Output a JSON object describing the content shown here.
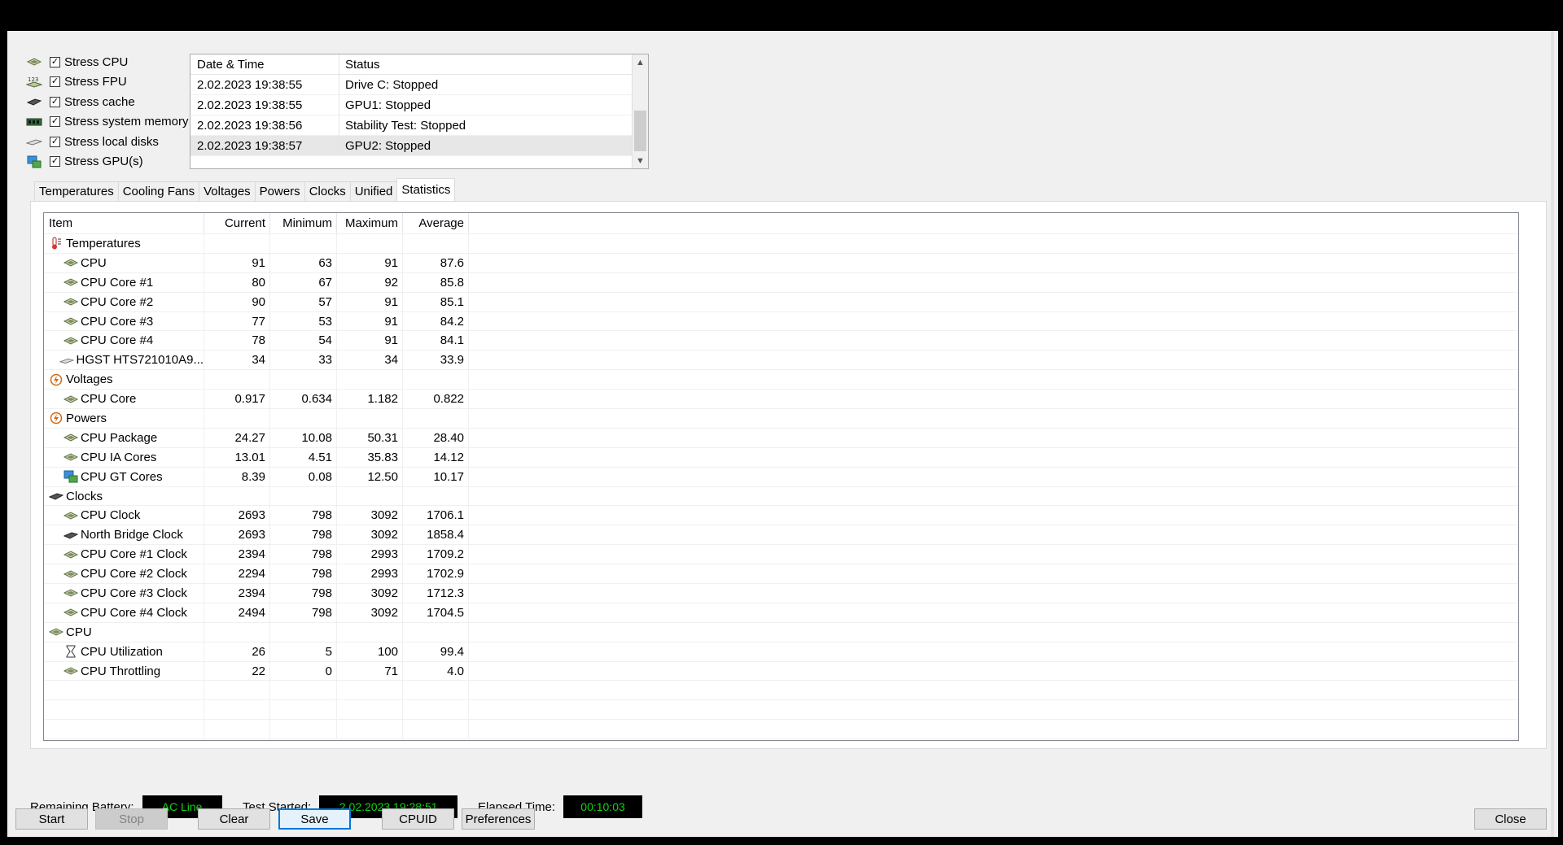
{
  "stress_options": [
    {
      "label": "Stress CPU",
      "checked": true,
      "icon": "cpu-chip-icon"
    },
    {
      "label": "Stress FPU",
      "checked": true,
      "icon": "fpu-numbers-icon"
    },
    {
      "label": "Stress cache",
      "checked": true,
      "icon": "cache-icon"
    },
    {
      "label": "Stress system memory",
      "checked": true,
      "icon": "memory-module-icon"
    },
    {
      "label": "Stress local disks",
      "checked": true,
      "icon": "disk-drive-icon"
    },
    {
      "label": "Stress GPU(s)",
      "checked": true,
      "icon": "gpu-icon"
    }
  ],
  "log": {
    "headers": {
      "datetime": "Date & Time",
      "status": "Status"
    },
    "rows": [
      {
        "datetime": "2.02.2023 19:38:55",
        "status": "Drive C: Stopped"
      },
      {
        "datetime": "2.02.2023 19:38:55",
        "status": "GPU1: Stopped"
      },
      {
        "datetime": "2.02.2023 19:38:56",
        "status": "Stability Test: Stopped"
      },
      {
        "datetime": "2.02.2023 19:38:57",
        "status": "GPU2: Stopped"
      }
    ]
  },
  "tabs": [
    "Temperatures",
    "Cooling Fans",
    "Voltages",
    "Powers",
    "Clocks",
    "Unified",
    "Statistics"
  ],
  "active_tab": "Statistics",
  "stats": {
    "headers": {
      "item": "Item",
      "current": "Current",
      "minimum": "Minimum",
      "maximum": "Maximum",
      "average": "Average"
    },
    "rows": [
      {
        "type": "group",
        "item": "Temperatures",
        "icon": "thermometer-icon"
      },
      {
        "type": "item",
        "item": "CPU",
        "icon": "cpu-chip-icon",
        "current": "91",
        "minimum": "63",
        "maximum": "91",
        "average": "87.6"
      },
      {
        "type": "item",
        "item": "CPU Core #1",
        "icon": "cpu-chip-icon",
        "current": "80",
        "minimum": "67",
        "maximum": "92",
        "average": "85.8"
      },
      {
        "type": "item",
        "item": "CPU Core #2",
        "icon": "cpu-chip-icon",
        "current": "90",
        "minimum": "57",
        "maximum": "91",
        "average": "85.1"
      },
      {
        "type": "item",
        "item": "CPU Core #3",
        "icon": "cpu-chip-icon",
        "current": "77",
        "minimum": "53",
        "maximum": "91",
        "average": "84.2"
      },
      {
        "type": "item",
        "item": "CPU Core #4",
        "icon": "cpu-chip-icon",
        "current": "78",
        "minimum": "54",
        "maximum": "91",
        "average": "84.1"
      },
      {
        "type": "item",
        "item": "HGST HTS721010A9...",
        "icon": "disk-drive-icon",
        "current": "34",
        "minimum": "33",
        "maximum": "34",
        "average": "33.9"
      },
      {
        "type": "group",
        "item": "Voltages",
        "icon": "voltage-icon"
      },
      {
        "type": "item",
        "item": "CPU Core",
        "icon": "cpu-chip-icon",
        "current": "0.917",
        "minimum": "0.634",
        "maximum": "1.182",
        "average": "0.822"
      },
      {
        "type": "group",
        "item": "Powers",
        "icon": "power-icon"
      },
      {
        "type": "item",
        "item": "CPU Package",
        "icon": "cpu-chip-icon",
        "current": "24.27",
        "minimum": "10.08",
        "maximum": "50.31",
        "average": "28.40"
      },
      {
        "type": "item",
        "item": "CPU IA Cores",
        "icon": "cpu-chip-icon",
        "current": "13.01",
        "minimum": "4.51",
        "maximum": "35.83",
        "average": "14.12"
      },
      {
        "type": "item",
        "item": "CPU GT Cores",
        "icon": "gpu-icon",
        "current": "8.39",
        "minimum": "0.08",
        "maximum": "12.50",
        "average": "10.17"
      },
      {
        "type": "group",
        "item": "Clocks",
        "icon": "clock-chip-icon"
      },
      {
        "type": "item",
        "item": "CPU Clock",
        "icon": "cpu-chip-icon",
        "current": "2693",
        "minimum": "798",
        "maximum": "3092",
        "average": "1706.1"
      },
      {
        "type": "item",
        "item": "North Bridge Clock",
        "icon": "northbridge-icon",
        "current": "2693",
        "minimum": "798",
        "maximum": "3092",
        "average": "1858.4"
      },
      {
        "type": "item",
        "item": "CPU Core #1 Clock",
        "icon": "cpu-chip-icon",
        "current": "2394",
        "minimum": "798",
        "maximum": "2993",
        "average": "1709.2"
      },
      {
        "type": "item",
        "item": "CPU Core #2 Clock",
        "icon": "cpu-chip-icon",
        "current": "2294",
        "minimum": "798",
        "maximum": "2993",
        "average": "1702.9"
      },
      {
        "type": "item",
        "item": "CPU Core #3 Clock",
        "icon": "cpu-chip-icon",
        "current": "2394",
        "minimum": "798",
        "maximum": "3092",
        "average": "1712.3"
      },
      {
        "type": "item",
        "item": "CPU Core #4 Clock",
        "icon": "cpu-chip-icon",
        "current": "2494",
        "minimum": "798",
        "maximum": "3092",
        "average": "1704.5"
      },
      {
        "type": "group",
        "item": "CPU",
        "icon": "cpu-chip-icon"
      },
      {
        "type": "item",
        "item": "CPU Utilization",
        "icon": "hourglass-icon",
        "current": "26",
        "minimum": "5",
        "maximum": "100",
        "average": "99.4"
      },
      {
        "type": "item",
        "item": "CPU Throttling",
        "icon": "cpu-chip-icon",
        "current": "22",
        "minimum": "0",
        "maximum": "71",
        "average": "4.0"
      }
    ]
  },
  "info": {
    "battery_label": "Remaining Battery:",
    "battery_value": "AC Line",
    "started_label": "Test Started:",
    "started_value": "2.02.2023 19:28:51",
    "elapsed_label": "Elapsed Time:",
    "elapsed_value": "00:10:03"
  },
  "buttons": {
    "start": "Start",
    "stop": "Stop",
    "clear": "Clear",
    "save": "Save",
    "cpuid": "CPUID",
    "preferences": "Preferences",
    "close": "Close"
  },
  "colors": {
    "lcd_text": "#11d416",
    "lcd_bg": "#000000",
    "focus": "#0078d7"
  }
}
